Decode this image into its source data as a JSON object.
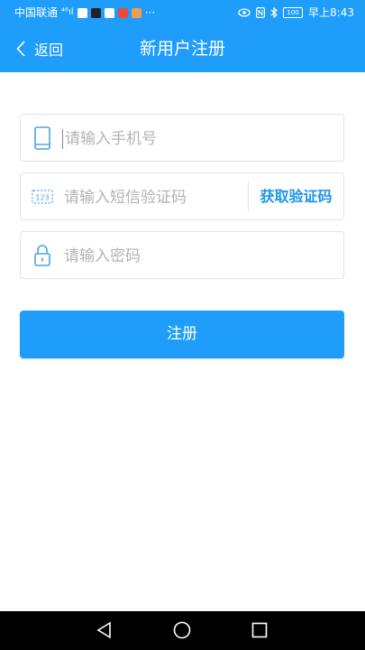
{
  "status_bar": {
    "carrier": "中国联通",
    "signal": "⁴⁶ıl",
    "more": "···",
    "battery": "100",
    "time": "早上8:43"
  },
  "nav": {
    "back_label": "返回",
    "title": "新用户注册"
  },
  "form": {
    "phone_placeholder": "请输入手机号",
    "code_placeholder": "请输入短信验证码",
    "get_code_label": "获取验证码",
    "password_placeholder": "请输入密码",
    "register_label": "注册"
  },
  "icons": {
    "phone": "phone-icon",
    "code": "123-icon",
    "lock": "lock-icon"
  },
  "colors": {
    "primary": "#1e9dfb",
    "link": "#1c95e8",
    "placeholder": "#b3b3b3",
    "border": "#e3e3e3"
  }
}
